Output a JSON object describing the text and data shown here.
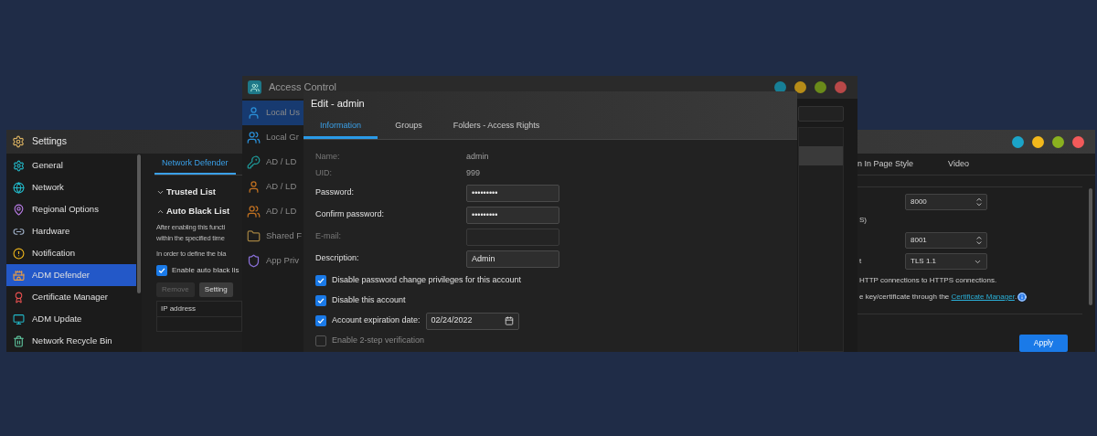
{
  "settings_window": {
    "title": "Settings",
    "sidebar": [
      {
        "label": "General",
        "selected": false
      },
      {
        "label": "Network",
        "selected": false
      },
      {
        "label": "Regional Options",
        "selected": false
      },
      {
        "label": "Hardware",
        "selected": false
      },
      {
        "label": "Notification",
        "selected": false
      },
      {
        "label": "ADM Defender",
        "selected": true
      },
      {
        "label": "Certificate Manager",
        "selected": false
      },
      {
        "label": "ADM Update",
        "selected": false
      },
      {
        "label": "Network Recycle Bin",
        "selected": false
      }
    ],
    "tabs": [
      {
        "label": "Network Defender",
        "selected": true
      }
    ],
    "sections": [
      {
        "title": "Trusted List",
        "expanded": false
      },
      {
        "title": "Auto Black List",
        "expanded": true
      }
    ],
    "description": [
      "After enabling this functi",
      "within the specified time",
      "In order to define the bla"
    ],
    "auto_black_list": {
      "label": "Enable auto black lis",
      "checked": true
    },
    "buttons": [
      {
        "label": "Remove",
        "disabled": true
      },
      {
        "label": "Setting",
        "disabled": false
      }
    ],
    "table": {
      "columns": [
        "IP address"
      ]
    },
    "right_tabs": [
      {
        "label": "n In Page Style",
        "selected": false
      },
      {
        "label": "Video",
        "selected": false
      }
    ],
    "right_rows": [
      {
        "kind": "spinner",
        "value": "8000"
      },
      {
        "kind": "text",
        "text": "S)"
      },
      {
        "kind": "spinner",
        "value": "8001"
      },
      {
        "kind": "select",
        "label": "t",
        "value": "TLS 1.1"
      },
      {
        "kind": "text",
        "text": "HTTP connections to HTTPS connections."
      },
      {
        "kind": "link_text",
        "text": "e key/certificate through the",
        "link": "Certificate Manager",
        "after": "."
      }
    ],
    "apply_button": "Apply"
  },
  "access_control_window": {
    "title": "Access Control",
    "sidebar": [
      {
        "label": "Local Us",
        "selected": true
      },
      {
        "label": "Local Gr",
        "selected": false
      },
      {
        "label": "AD / LD",
        "selected": false
      },
      {
        "label": "AD / LD",
        "selected": false
      },
      {
        "label": "AD / LD",
        "selected": false
      },
      {
        "label": "Shared F",
        "selected": false
      },
      {
        "label": "App Priv",
        "selected": false
      }
    ]
  },
  "edit_dialog": {
    "title": "Edit - admin",
    "tabs": [
      {
        "label": "Information",
        "selected": true
      },
      {
        "label": "Groups",
        "selected": false
      },
      {
        "label": "Folders - Access Rights",
        "selected": false
      }
    ],
    "fields": [
      {
        "kind": "readonly",
        "label": "Name:",
        "value": "admin"
      },
      {
        "kind": "readonly",
        "label": "UID:",
        "value": "999"
      },
      {
        "kind": "input",
        "label": "Password:",
        "value": "•••••••••",
        "disabled": false
      },
      {
        "kind": "input",
        "label": "Confirm password:",
        "value": "•••••••••",
        "disabled": false
      },
      {
        "kind": "input",
        "label": "E-mail:",
        "disabled": true
      },
      {
        "kind": "input",
        "label": "Description:",
        "value": "Admin",
        "disabled": false
      }
    ],
    "options": [
      {
        "label": "Disable password change privileges for this account",
        "checked": true
      },
      {
        "label": "Disable this account",
        "checked": true
      },
      {
        "label": "Account expiration date:",
        "checked": true,
        "date": "02/24/2022"
      },
      {
        "label": "Enable 2-step verification",
        "checked": false
      }
    ]
  }
}
